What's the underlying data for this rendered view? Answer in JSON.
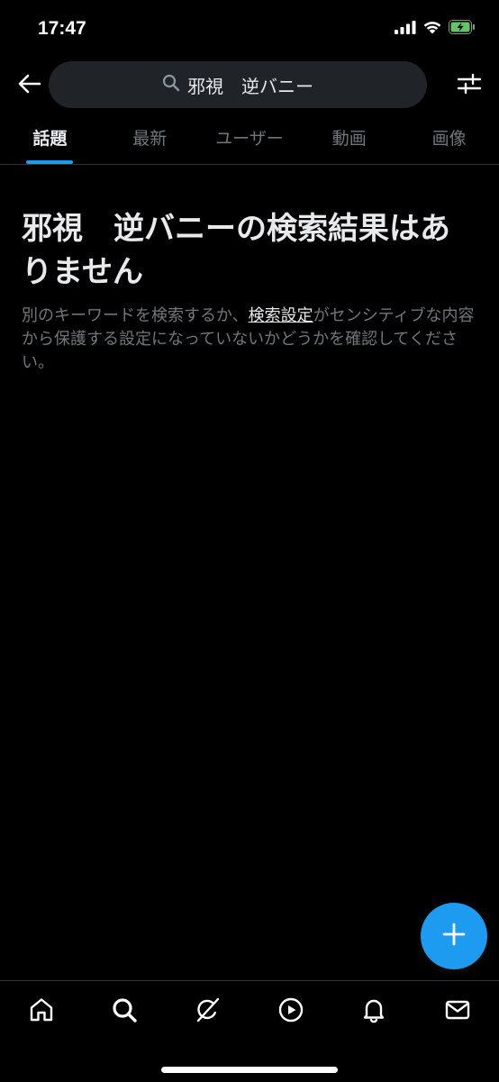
{
  "status_bar": {
    "time": "17:47",
    "icons": [
      "signal-icon",
      "wifi-icon",
      "battery-charging-icon"
    ]
  },
  "header": {
    "back_icon": "arrow-left-icon",
    "search_value": "邪視　逆バニー",
    "search_icon": "search-icon",
    "filter_icon": "sliders-icon"
  },
  "tabs": [
    {
      "label": "話題",
      "active": true
    },
    {
      "label": "最新",
      "active": false
    },
    {
      "label": "ユーザー",
      "active": false
    },
    {
      "label": "動画",
      "active": false
    },
    {
      "label": "画像",
      "active": false
    }
  ],
  "empty_state": {
    "title": "邪視　逆バニーの検索結果はありません",
    "desc_before": "別のキーワードを検索するか、",
    "desc_link": "検索設定",
    "desc_after": "がセンシティブな内容から保護する設定になっていないかどうかを確認してください。"
  },
  "fab": {
    "icon": "plus-icon"
  },
  "bottom_nav": {
    "items": [
      "home-icon",
      "search-icon",
      "grok-icon",
      "video-play-icon",
      "bell-icon",
      "mail-icon"
    ]
  },
  "colors": {
    "accent": "#1d9bf0",
    "background": "#000000",
    "text_primary": "#e7e9ea",
    "text_secondary": "#71767b",
    "search_bg": "#202327",
    "divider": "#2f3336",
    "battery": "#65c466"
  }
}
